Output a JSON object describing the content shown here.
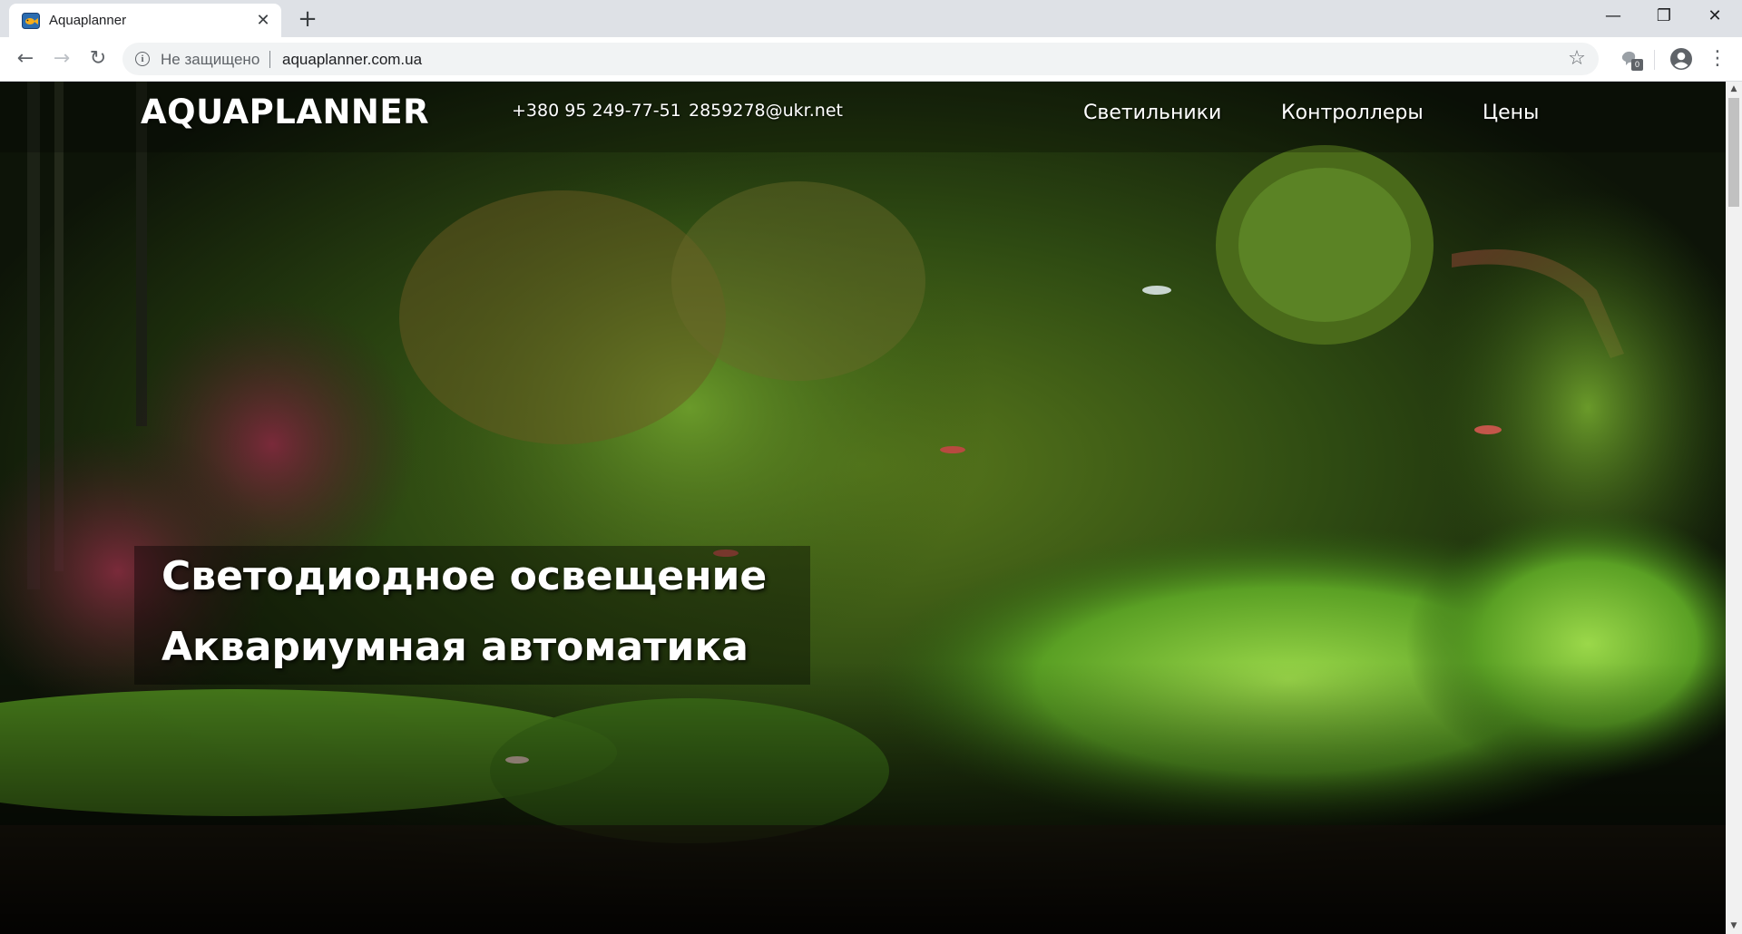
{
  "browser": {
    "tab": {
      "title": "Aquaplanner",
      "close_glyph": "✕"
    },
    "new_tab_glyph": "+",
    "window_controls": {
      "minimize": "—",
      "restore": "❐",
      "close": "✕"
    },
    "toolbar": {
      "back_glyph": "←",
      "forward_glyph": "→",
      "reload_glyph": "↻",
      "security_text": "Не защищено",
      "url": "aquaplanner.com.ua",
      "star_glyph": "☆",
      "extension_badge": "0",
      "menu_glyph": "⋮"
    }
  },
  "site": {
    "logo": "AQUAPLANNER",
    "phone": "+380 95 249-77-51",
    "email": "2859278@ukr.net",
    "nav": [
      "Светильники",
      "Контроллеры",
      "Цены"
    ],
    "hero": {
      "line1": "Светодиодное освещение",
      "line2": "Аквариумная автоматика"
    }
  },
  "colors": {
    "chrome_bg": "#dee1e6",
    "toolbar_bg": "#ffffff",
    "omnibox_bg": "#f1f3f4",
    "text_white": "#ffffff"
  },
  "icons": [
    "fish-favicon-icon",
    "back-arrow-icon",
    "forward-arrow-icon",
    "reload-icon",
    "info-icon",
    "star-icon",
    "extension-icon",
    "account-icon",
    "menu-icon"
  ]
}
